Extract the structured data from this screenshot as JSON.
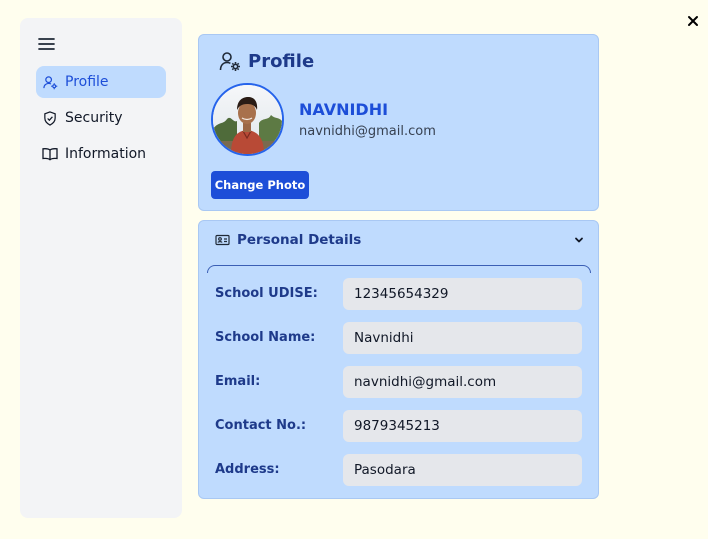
{
  "window": {
    "close_label": "×"
  },
  "sidebar": {
    "items": [
      {
        "label": "Profile",
        "icon": "user-gear-icon",
        "active": true
      },
      {
        "label": "Security",
        "icon": "shield-check-icon",
        "active": false
      },
      {
        "label": "Information",
        "icon": "book-open-icon",
        "active": false
      }
    ]
  },
  "profile": {
    "title": "Profile",
    "name": "NAVNIDHI",
    "email": "navnidhi@gmail.com",
    "change_photo_label": "Change Photo"
  },
  "details": {
    "title": "Personal Details",
    "fields": [
      {
        "label": "School UDISE:",
        "value": "12345654329"
      },
      {
        "label": "School Name:",
        "value": "Navnidhi"
      },
      {
        "label": "Email:",
        "value": "navnidhi@gmail.com"
      },
      {
        "label": "Contact No.:",
        "value": "9879345213"
      },
      {
        "label": "Address:",
        "value": "Pasodara"
      }
    ]
  },
  "colors": {
    "accent": "#1d4ed8",
    "card_bg": "#bfdbfe",
    "sidebar_bg": "#f3f4f6",
    "field_bg": "#e5e7eb",
    "page_bg": "#fffeee"
  }
}
